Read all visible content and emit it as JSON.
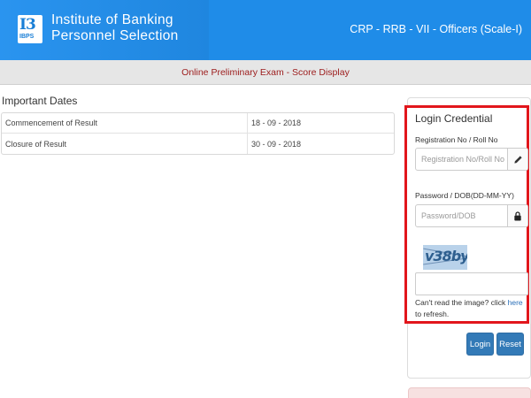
{
  "header": {
    "logo_mark": "IBPS",
    "logo_line1": "Institute of Banking",
    "logo_line2": "Personnel Selection",
    "exam_title": "CRP - RRB - VII - Officers (Scale-I)"
  },
  "subheader": {
    "title": "Online Preliminary Exam - Score Display"
  },
  "important_dates": {
    "heading": "Important Dates",
    "rows": [
      {
        "label": "Commencement of Result",
        "value": "18 - 09 - 2018"
      },
      {
        "label": "Closure of Result",
        "value": "30 - 09 - 2018"
      }
    ]
  },
  "login": {
    "title": "Login Credential",
    "reg_label": "Registration No / Roll No",
    "reg_placeholder": "Registration No/Roll No",
    "reg_icon": "pencil-icon",
    "pwd_label": "Password / DOB(DD-MM-YY)",
    "pwd_placeholder": "Password/DOB",
    "pwd_icon": "lock-icon",
    "captcha_text": "v38by",
    "captcha_hint_prefix": "Can't read the image? click ",
    "captcha_hint_link": "here",
    "captcha_hint_suffix": " to refresh.",
    "login_button": "Login",
    "reset_button": "Reset"
  },
  "colors": {
    "header_blue": "#1f8ce8",
    "subheader_text": "#9c1b1b",
    "highlight_red": "#e2161c",
    "button_blue": "#337ab7"
  }
}
